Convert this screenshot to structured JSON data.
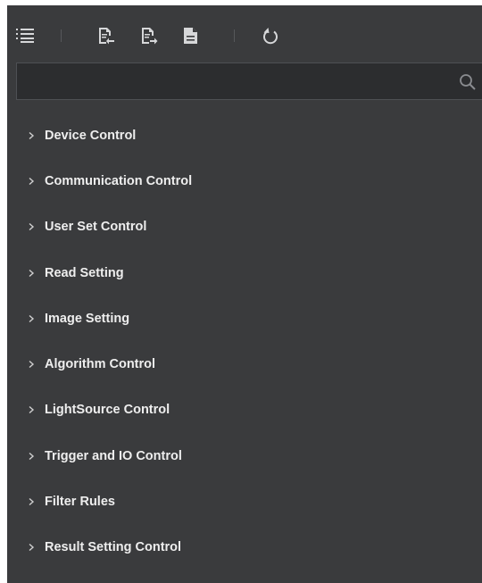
{
  "toolbar": {
    "buttons": [
      {
        "icon": "collapse-all-icon"
      },
      {
        "icon": "import-icon"
      },
      {
        "icon": "export-icon"
      },
      {
        "icon": "document-icon"
      },
      {
        "icon": "refresh-icon"
      }
    ]
  },
  "search": {
    "placeholder": "",
    "value": "",
    "icon": "search-icon"
  },
  "tree": {
    "items": [
      {
        "label": "Device Control"
      },
      {
        "label": "Communication Control"
      },
      {
        "label": "User Set Control"
      },
      {
        "label": "Read Setting"
      },
      {
        "label": "Image Setting"
      },
      {
        "label": "Algorithm Control"
      },
      {
        "label": "LightSource Control"
      },
      {
        "label": "Trigger and IO Control"
      },
      {
        "label": "Filter Rules"
      },
      {
        "label": "Result Setting Control"
      }
    ]
  },
  "colors": {
    "panel_bg": "#3a3b3d",
    "search_bg": "#2c2d2f",
    "text": "#eeeeee",
    "icon": "#d6d7d9"
  }
}
